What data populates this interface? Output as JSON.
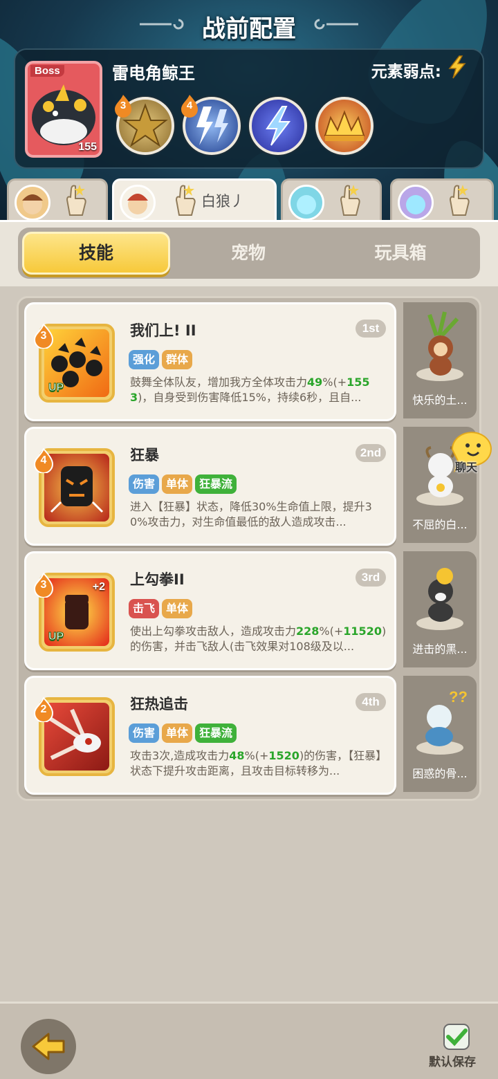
{
  "header": {
    "title": "战前配置"
  },
  "boss": {
    "tag": "Boss",
    "level": "155",
    "name": "雷电角鲸王",
    "weakness_label": "元素弱点:",
    "weakness_icon": "lightning-icon",
    "skills": [
      {
        "level": "3",
        "icon": "golden-burst-icon"
      },
      {
        "level": "4",
        "icon": "blue-lightning-icon"
      },
      {
        "level": "",
        "icon": "lightning-bolt-icon"
      },
      {
        "level": "",
        "icon": "golden-spike-crown-icon"
      }
    ]
  },
  "char_tabs": [
    {
      "name": "",
      "active": false
    },
    {
      "name": "白狼丿",
      "active": true
    },
    {
      "name": "",
      "active": false
    },
    {
      "name": "",
      "active": false
    }
  ],
  "segments": {
    "skill": "技能",
    "pet": "宠物",
    "toybox": "玩具箱",
    "active": "skill"
  },
  "skills": [
    {
      "level": "3",
      "title": "我们上! II",
      "order": "1st",
      "up": "UP",
      "tags": [
        {
          "label": "强化",
          "color": "#5b9ed8"
        },
        {
          "label": "群体",
          "color": "#e8a84a"
        }
      ],
      "desc_before": "鼓舞全体队友，增加我方全体攻击力",
      "desc_hl1": "49",
      "desc_mid1": "%(+",
      "desc_hl2": "1553",
      "desc_after": ")，自身受到伤害降低15%，持续6秒，且自...",
      "pet": "快乐的土..."
    },
    {
      "level": "4",
      "title": "狂暴",
      "order": "2nd",
      "up": "",
      "tags": [
        {
          "label": "伤害",
          "color": "#5b9ed8"
        },
        {
          "label": "单体",
          "color": "#e8a84a"
        },
        {
          "label": "狂暴流",
          "color": "#3fb13a"
        }
      ],
      "desc_before": "进入【狂暴】状态，降低30%生命值上限，提升30%攻击力，对生命值最低的敌人造成攻击...",
      "desc_hl1": "",
      "desc_mid1": "",
      "desc_hl2": "",
      "desc_after": "",
      "pet": "不屈的白..."
    },
    {
      "level": "3",
      "title": "上勾拳II",
      "order": "3rd",
      "up": "UP",
      "plus": "+2",
      "tags": [
        {
          "label": "击飞",
          "color": "#d9534f"
        },
        {
          "label": "单体",
          "color": "#e8a84a"
        }
      ],
      "desc_before": "使出上勾拳攻击敌人，造成攻击力",
      "desc_hl1": "228",
      "desc_mid1": "%(+",
      "desc_hl2": "11520",
      "desc_after": ")的伤害，并击飞敌人(击飞效果对108级及以...",
      "pet": "进击的黑..."
    },
    {
      "level": "2",
      "title": "狂热追击",
      "order": "4th",
      "up": "",
      "tags": [
        {
          "label": "伤害",
          "color": "#5b9ed8"
        },
        {
          "label": "单体",
          "color": "#e8a84a"
        },
        {
          "label": "狂暴流",
          "color": "#3fb13a"
        }
      ],
      "desc_before": "攻击3次,造成攻击力",
      "desc_hl1": "48",
      "desc_mid1": "%(+",
      "desc_hl2": "1520",
      "desc_after": ")的伤害，【狂暴】状态下提升攻击距离，且攻击目标转移为...",
      "pet": "困惑的骨..."
    }
  ],
  "chat": {
    "label": "聊天"
  },
  "footer": {
    "save_label": "默认保存"
  }
}
